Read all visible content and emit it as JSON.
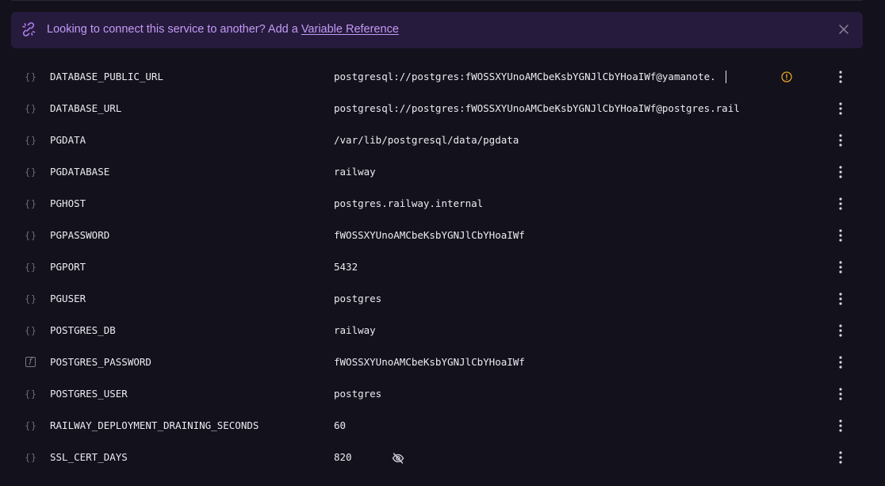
{
  "banner": {
    "text": "Looking to connect this service to another? Add a ",
    "link_label": "Variable Reference"
  },
  "colors": {
    "accent": "#c49af7",
    "banner_bg": "#261b3c",
    "warning": "#e5a520"
  },
  "variables": [
    {
      "icon": "braces-icon",
      "name": "DATABASE_PUBLIC_URL",
      "value": "postgresql://postgres:fWOSSXYUnoAMCbeKsbYGNJlCbYHoaIWf@yamanote."
    },
    {
      "icon": "braces-icon",
      "name": "DATABASE_URL",
      "value": "postgresql://postgres:fWOSSXYUnoAMCbeKsbYGNJlCbYHoaIWf@postgres.rail"
    },
    {
      "icon": "braces-icon",
      "name": "PGDATA",
      "value": "/var/lib/postgresql/data/pgdata"
    },
    {
      "icon": "braces-icon",
      "name": "PGDATABASE",
      "value": "railway"
    },
    {
      "icon": "braces-icon",
      "name": "PGHOST",
      "value": "postgres.railway.internal"
    },
    {
      "icon": "braces-icon",
      "name": "PGPASSWORD",
      "value": "fWOSSXYUnoAMCbeKsbYGNJlCbYHoaIWf"
    },
    {
      "icon": "braces-icon",
      "name": "PGPORT",
      "value": "5432"
    },
    {
      "icon": "braces-icon",
      "name": "PGUSER",
      "value": "postgres"
    },
    {
      "icon": "braces-icon",
      "name": "POSTGRES_DB",
      "value": "railway"
    },
    {
      "icon": "function-icon",
      "name": "POSTGRES_PASSWORD",
      "value": "fWOSSXYUnoAMCbeKsbYGNJlCbYHoaIWf"
    },
    {
      "icon": "braces-icon",
      "name": "POSTGRES_USER",
      "value": "postgres"
    },
    {
      "icon": "braces-icon",
      "name": "RAILWAY_DEPLOYMENT_DRAINING_SECONDS",
      "value": "60"
    },
    {
      "icon": "braces-icon",
      "name": "SSL_CERT_DAYS",
      "value": "820"
    }
  ],
  "row_icons": {
    "braces_glyph": "{}"
  }
}
